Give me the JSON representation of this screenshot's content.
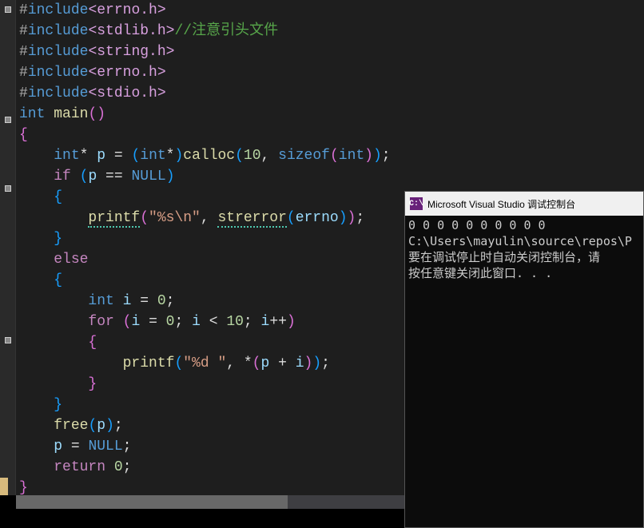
{
  "code": {
    "lines": [
      {
        "indent": 0,
        "segs": [
          {
            "t": "#",
            "c": "pp"
          },
          {
            "t": "include",
            "c": "inc"
          },
          {
            "t": "<errno.h>",
            "c": "hdr"
          }
        ]
      },
      {
        "indent": 0,
        "segs": [
          {
            "t": "#",
            "c": "pp"
          },
          {
            "t": "include",
            "c": "inc"
          },
          {
            "t": "<stdlib.h>",
            "c": "hdr"
          },
          {
            "t": "//注意引头文件",
            "c": "cmt"
          }
        ]
      },
      {
        "indent": 0,
        "segs": [
          {
            "t": "#",
            "c": "pp"
          },
          {
            "t": "include",
            "c": "inc"
          },
          {
            "t": "<string.h>",
            "c": "hdr"
          }
        ]
      },
      {
        "indent": 0,
        "segs": [
          {
            "t": "#",
            "c": "pp"
          },
          {
            "t": "include",
            "c": "inc"
          },
          {
            "t": "<errno.h>",
            "c": "hdr"
          }
        ]
      },
      {
        "indent": 0,
        "segs": [
          {
            "t": "#",
            "c": "pp"
          },
          {
            "t": "include",
            "c": "inc"
          },
          {
            "t": "<stdio.h>",
            "c": "hdr"
          }
        ]
      },
      {
        "indent": 0,
        "segs": [
          {
            "t": "int ",
            "c": "kw"
          },
          {
            "t": "main",
            "c": "fn"
          },
          {
            "t": "()",
            "c": "paren"
          }
        ]
      },
      {
        "indent": 0,
        "segs": [
          {
            "t": "{",
            "c": "paren"
          }
        ]
      },
      {
        "indent": 1,
        "segs": [
          {
            "t": "int",
            "c": "kw"
          },
          {
            "t": "* ",
            "c": "op"
          },
          {
            "t": "p",
            "c": "id"
          },
          {
            "t": " = ",
            "c": "op"
          },
          {
            "t": "(",
            "c": "paren2"
          },
          {
            "t": "int",
            "c": "kw"
          },
          {
            "t": "*",
            "c": "op"
          },
          {
            "t": ")",
            "c": "paren2"
          },
          {
            "t": "calloc",
            "c": "fn"
          },
          {
            "t": "(",
            "c": "paren2"
          },
          {
            "t": "10",
            "c": "num"
          },
          {
            "t": ", ",
            "c": "op"
          },
          {
            "t": "sizeof",
            "c": "kw"
          },
          {
            "t": "(",
            "c": "paren"
          },
          {
            "t": "int",
            "c": "kw"
          },
          {
            "t": ")",
            "c": "paren"
          },
          {
            "t": ")",
            "c": "paren2"
          },
          {
            "t": ";",
            "c": "op"
          }
        ]
      },
      {
        "indent": 1,
        "segs": [
          {
            "t": "if ",
            "c": "kwv"
          },
          {
            "t": "(",
            "c": "paren2"
          },
          {
            "t": "p",
            "c": "id"
          },
          {
            "t": " == ",
            "c": "op"
          },
          {
            "t": "NULL",
            "c": "kw"
          },
          {
            "t": ")",
            "c": "paren2"
          }
        ]
      },
      {
        "indent": 1,
        "segs": [
          {
            "t": "{",
            "c": "paren2"
          }
        ]
      },
      {
        "indent": 2,
        "segs": [
          {
            "t": "printf",
            "c": "fn",
            "squiggle": true
          },
          {
            "t": "(",
            "c": "paren"
          },
          {
            "t": "\"%s\\n\"",
            "c": "str"
          },
          {
            "t": ", ",
            "c": "op"
          },
          {
            "t": "strerror",
            "c": "fn",
            "squiggle": true
          },
          {
            "t": "(",
            "c": "paren2"
          },
          {
            "t": "errno",
            "c": "id"
          },
          {
            "t": ")",
            "c": "paren2"
          },
          {
            "t": ")",
            "c": "paren"
          },
          {
            "t": ";",
            "c": "op"
          }
        ]
      },
      {
        "indent": 1,
        "segs": [
          {
            "t": "}",
            "c": "paren2"
          }
        ]
      },
      {
        "indent": 1,
        "segs": [
          {
            "t": "else",
            "c": "kwv"
          }
        ]
      },
      {
        "indent": 1,
        "segs": [
          {
            "t": "{",
            "c": "paren2"
          }
        ]
      },
      {
        "indent": 2,
        "segs": [
          {
            "t": "int ",
            "c": "kw"
          },
          {
            "t": "i",
            "c": "id"
          },
          {
            "t": " = ",
            "c": "op"
          },
          {
            "t": "0",
            "c": "num"
          },
          {
            "t": ";",
            "c": "op"
          }
        ]
      },
      {
        "indent": 2,
        "segs": [
          {
            "t": "for ",
            "c": "kwv"
          },
          {
            "t": "(",
            "c": "paren"
          },
          {
            "t": "i",
            "c": "id"
          },
          {
            "t": " = ",
            "c": "op"
          },
          {
            "t": "0",
            "c": "num"
          },
          {
            "t": "; ",
            "c": "op"
          },
          {
            "t": "i",
            "c": "id"
          },
          {
            "t": " < ",
            "c": "op"
          },
          {
            "t": "10",
            "c": "num"
          },
          {
            "t": "; ",
            "c": "op"
          },
          {
            "t": "i",
            "c": "id"
          },
          {
            "t": "++",
            "c": "op"
          },
          {
            "t": ")",
            "c": "paren"
          }
        ]
      },
      {
        "indent": 2,
        "segs": [
          {
            "t": "{",
            "c": "paren"
          }
        ]
      },
      {
        "indent": 3,
        "segs": [
          {
            "t": "printf",
            "c": "fn"
          },
          {
            "t": "(",
            "c": "paren2"
          },
          {
            "t": "\"%d \"",
            "c": "str"
          },
          {
            "t": ", *",
            "c": "op"
          },
          {
            "t": "(",
            "c": "paren"
          },
          {
            "t": "p",
            "c": "id"
          },
          {
            "t": " + ",
            "c": "op"
          },
          {
            "t": "i",
            "c": "id"
          },
          {
            "t": ")",
            "c": "paren"
          },
          {
            "t": ")",
            "c": "paren2"
          },
          {
            "t": ";",
            "c": "op"
          }
        ]
      },
      {
        "indent": 2,
        "segs": [
          {
            "t": "}",
            "c": "paren"
          }
        ]
      },
      {
        "indent": 1,
        "segs": [
          {
            "t": "}",
            "c": "paren2"
          }
        ]
      },
      {
        "indent": 1,
        "segs": [
          {
            "t": "free",
            "c": "fn"
          },
          {
            "t": "(",
            "c": "paren2"
          },
          {
            "t": "p",
            "c": "id"
          },
          {
            "t": ")",
            "c": "paren2"
          },
          {
            "t": ";",
            "c": "op"
          }
        ]
      },
      {
        "indent": 1,
        "segs": [
          {
            "t": "p",
            "c": "id"
          },
          {
            "t": " = ",
            "c": "op"
          },
          {
            "t": "NULL",
            "c": "kw"
          },
          {
            "t": ";",
            "c": "op"
          }
        ]
      },
      {
        "indent": 1,
        "segs": [
          {
            "t": "return ",
            "c": "kwv"
          },
          {
            "t": "0",
            "c": "num"
          },
          {
            "t": ";",
            "c": "op"
          }
        ]
      },
      {
        "indent": 0,
        "segs": [
          {
            "t": "}",
            "c": "paren"
          }
        ]
      }
    ],
    "folds": [
      0,
      5,
      8,
      15
    ]
  },
  "console": {
    "icon_text": "C:\\",
    "title": "Microsoft Visual Studio 调试控制台",
    "lines": [
      "0 0 0 0 0 0 0 0 0 0",
      "C:\\Users\\mayulin\\source\\repos\\P",
      "要在调试停止时自动关闭控制台，请",
      "按任意键关闭此窗口. . ."
    ]
  }
}
